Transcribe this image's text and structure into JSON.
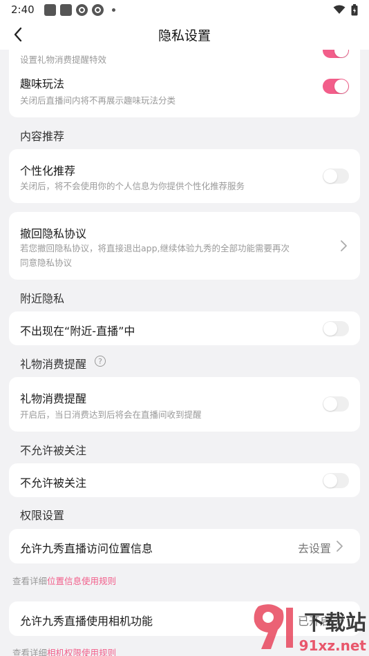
{
  "status": {
    "time": "2:40"
  },
  "nav": {
    "title": "隐私设置"
  },
  "top_card": {
    "partial_desc": "设置礼物消费提醒特效",
    "fun": {
      "title": "趣味玩法",
      "desc": "关闭后直播间内将不再展示趣味玩法分类",
      "on": true
    }
  },
  "content_rec": {
    "section": "内容推荐",
    "item": {
      "title": "个性化推荐",
      "desc": "关闭后，将不会使用你的个人信息为你提供个性化推荐服务",
      "on": false
    }
  },
  "revoke": {
    "title": "撤回隐私协议",
    "desc_line1": "若您撤回隐私协议，将直接退出app,继续体验九秀的全部功能需要再次",
    "desc_line2": "同意隐私协议"
  },
  "nearby": {
    "section": "附近隐私",
    "item": {
      "title": "不出现在“附近-直播”中",
      "on": false
    }
  },
  "gift": {
    "section": "礼物消费提醒",
    "help": "?",
    "item": {
      "title": "礼物消费提醒",
      "desc": "开启后，当日消费达到后将会在直播间收到提醒",
      "on": false
    }
  },
  "follow": {
    "section": "不允许被关注",
    "item": {
      "title": "不允许被关注",
      "on": false
    }
  },
  "permission": {
    "section": "权限设置",
    "location": {
      "title": "允许九秀直播访问位置信息",
      "action": "去设置"
    },
    "location_note": {
      "prefix": "查看详细",
      "link": "位置信息使用规则"
    },
    "camera": {
      "title": "允许九秀直播使用相机功能",
      "action": "已开启"
    },
    "camera_note": {
      "prefix": "查看详细",
      "link": "相机权限使用规则"
    }
  },
  "watermark": {
    "brand": "下载站",
    "domain": "91xz.net"
  },
  "colors": {
    "accent": "#f25e8a",
    "toggle_off": "#efefef"
  }
}
